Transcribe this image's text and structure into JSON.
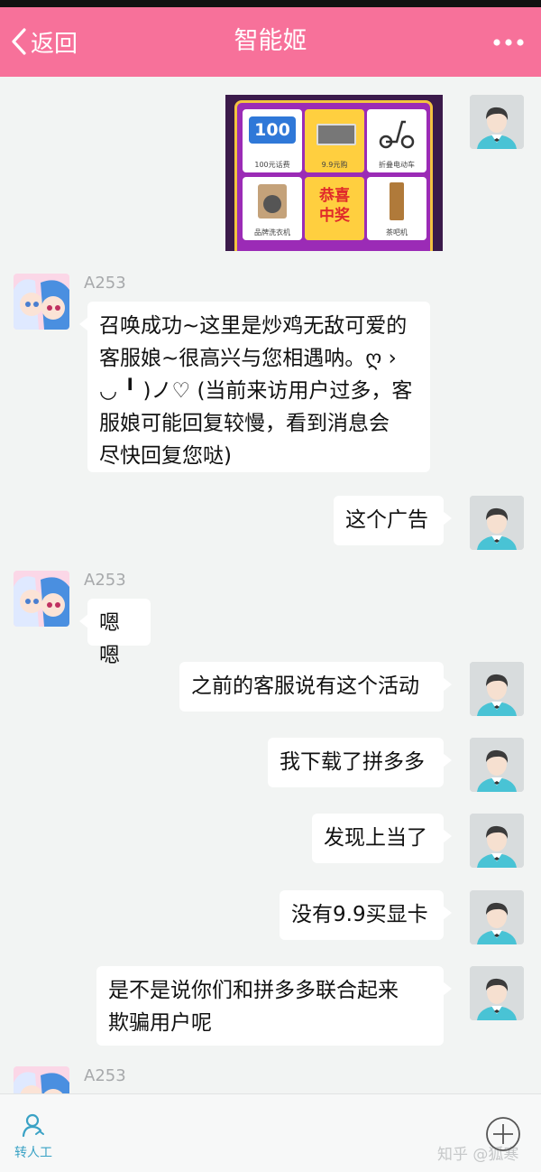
{
  "header": {
    "back_label": "返回",
    "title": "智能姬",
    "more_icon": "more-dots-icon",
    "bg_color": "#f7719a"
  },
  "promo_image": {
    "tiles": [
      {
        "label": "100元话费",
        "badge": "100"
      },
      {
        "label": "9.9元购"
      },
      {
        "label": "折叠电动车"
      },
      {
        "label": "品牌洗衣机"
      },
      {
        "label": "恭喜中奖"
      },
      {
        "label": "茶吧机"
      }
    ]
  },
  "messages": [
    {
      "side": "left",
      "sender": "A253",
      "text_lines": [
        "召唤成功~这里是炒鸡无敌可爱的",
        "客服娘~很高兴与您相遇呐。ღ ›",
        "◡ ╹ )ノ♡ (当前来访用户过多，客",
        "服娘可能回复较慢，看到消息会",
        "尽快回复您哒)"
      ]
    },
    {
      "side": "right",
      "text": "这个广告"
    },
    {
      "side": "left",
      "sender": "A253",
      "text": "嗯嗯"
    },
    {
      "side": "right",
      "text": "之前的客服说有这个活动"
    },
    {
      "side": "right",
      "text": "我下载了拼多多"
    },
    {
      "side": "right",
      "text": "发现上当了"
    },
    {
      "side": "right",
      "text": "没有9.9买显卡"
    },
    {
      "side": "right",
      "text_lines": [
        "是不是说你们和拼多多联合起来",
        "欺骗用户呢"
      ]
    },
    {
      "side": "left",
      "sender": "A253"
    }
  ],
  "bottom": {
    "transfer_label": "转人工",
    "watermark": "知乎 @狐寒"
  }
}
